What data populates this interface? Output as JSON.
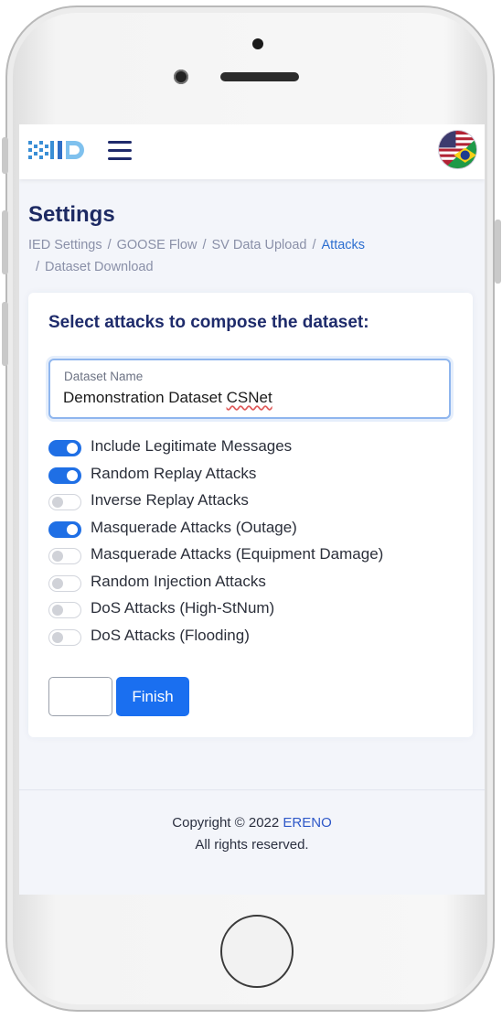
{
  "header": {
    "logo_alt": "IED",
    "menu_icon": "hamburger-icon",
    "language_icon": "us-br-flag-icon"
  },
  "page": {
    "title": "Settings",
    "breadcrumbs": [
      {
        "label": "IED Settings",
        "active": false
      },
      {
        "label": "GOOSE Flow",
        "active": false
      },
      {
        "label": "SV Data Upload",
        "active": false
      },
      {
        "label": "Attacks",
        "active": true
      },
      {
        "label": "Dataset Download",
        "active": false
      }
    ],
    "separator": "/"
  },
  "card": {
    "title": "Select attacks to compose the dataset:",
    "dataset_field": {
      "label": "Dataset Name",
      "value_prefix": "Demonstration Dataset ",
      "value_misspelled": "CSNet"
    },
    "toggles": [
      {
        "label": "Include Legitimate Messages",
        "checked": true
      },
      {
        "label": "Random Replay Attacks",
        "checked": true
      },
      {
        "label": "Inverse Replay Attacks",
        "checked": false
      },
      {
        "label": "Masquerade Attacks (Outage)",
        "checked": true
      },
      {
        "label": "Masquerade Attacks (Equipment Damage)",
        "checked": false
      },
      {
        "label": "Random Injection Attacks",
        "checked": false
      },
      {
        "label": "DoS Attacks (High-StNum)",
        "checked": false
      },
      {
        "label": "DoS Attacks (Flooding)",
        "checked": false
      }
    ],
    "finish_label": "Finish"
  },
  "footer": {
    "copyright_prefix": "Copyright © 2022 ",
    "brand": "ERENO",
    "rights": "All rights reserved."
  },
  "colors": {
    "accent": "#1a6ff0",
    "title": "#1d2a63",
    "link": "#2e58c8"
  }
}
